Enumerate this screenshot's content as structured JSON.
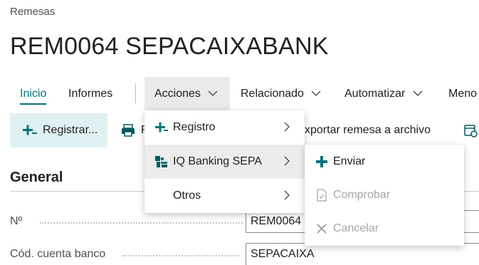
{
  "breadcrumb": "Remesas",
  "title": "REM0064 SEPACAIXABANK",
  "tabs": [
    {
      "label": "Inicio"
    },
    {
      "label": "Informes"
    },
    {
      "label": "Acciones"
    },
    {
      "label": "Relacionado"
    },
    {
      "label": "Automatizar"
    },
    {
      "label": "Meno"
    }
  ],
  "actions": {
    "registrar": "Registrar...",
    "second_partial": "R",
    "exportar": "xportar remesa a archivo"
  },
  "acciones_menu": {
    "items": [
      {
        "label": "Registro",
        "icon": "plus-icon"
      },
      {
        "label": "IQ Banking SEPA",
        "icon": "bank-icon"
      },
      {
        "label": "Otros"
      }
    ]
  },
  "submenu": {
    "items": [
      {
        "label": "Enviar",
        "icon": "plus-icon",
        "enabled": true
      },
      {
        "label": "Comprobar",
        "icon": "document-check-icon",
        "enabled": false
      },
      {
        "label": "Cancelar",
        "icon": "close-icon",
        "enabled": false
      }
    ]
  },
  "general": {
    "title": "General",
    "fields": [
      {
        "label": "Nº",
        "value": "REM0064"
      },
      {
        "label": "Cód. cuenta banco",
        "value": "SEPACAIXA"
      }
    ]
  },
  "colors": {
    "accent": "#00747a",
    "primary_bg": "#dff1f2",
    "disabled": "#a6a6a6"
  }
}
